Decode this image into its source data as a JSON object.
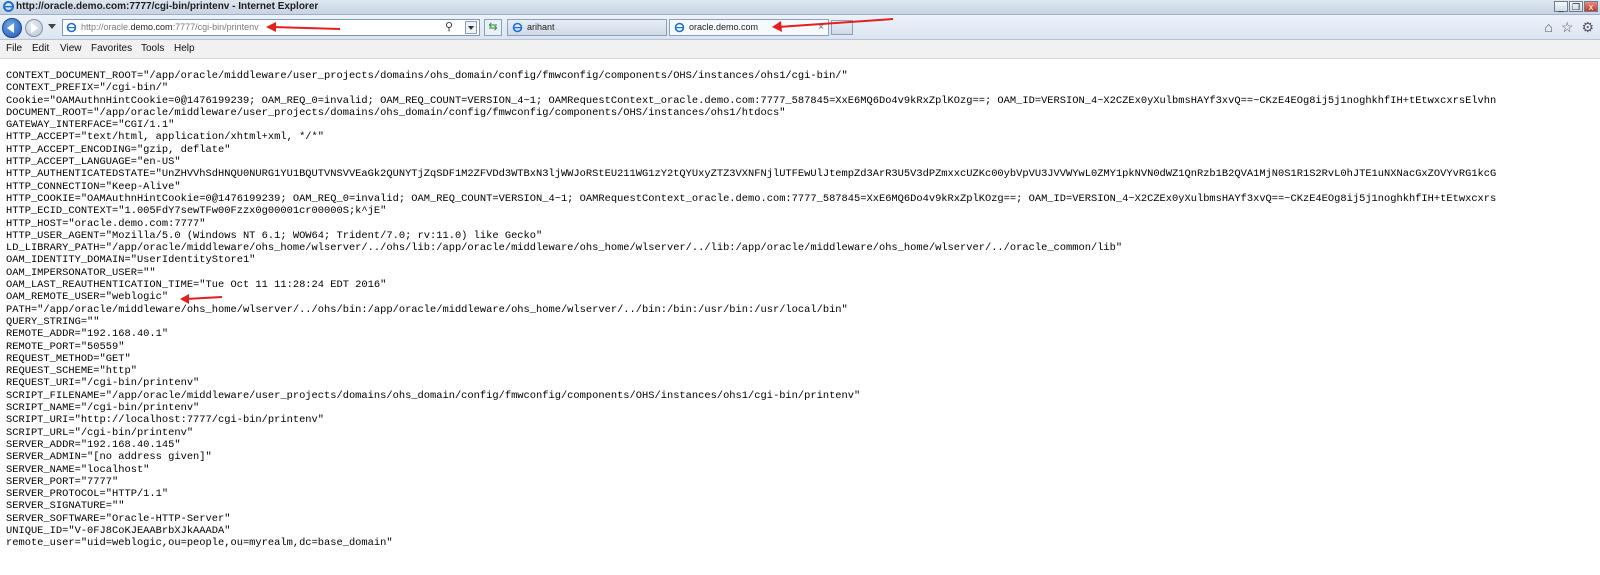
{
  "window": {
    "title": "http://oracle.demo.com:7777/cgi-bin/printenv - Internet Explorer",
    "icon": "ie-icon",
    "buttons": [
      "minimize",
      "restore",
      "close"
    ]
  },
  "navigation": {
    "back_icon": "back-arrow-icon",
    "forward_icon": "forward-arrow-icon",
    "address": {
      "prefix": "http://oracle.",
      "host": "demo.com",
      "suffix": ":7777/cgi-bin/printenv"
    },
    "tabs": [
      {
        "label": "arihant",
        "active": false
      },
      {
        "label": "oracle.demo.com",
        "active": true,
        "close": "×"
      }
    ],
    "right_icons": [
      "home-icon",
      "star-icon",
      "gear-icon"
    ]
  },
  "menu": {
    "items": [
      "File",
      "Edit",
      "View",
      "Favorites",
      "Tools",
      "Help"
    ]
  },
  "content": {
    "lines": [
      "CONTEXT_DOCUMENT_ROOT=\"/app/oracle/middleware/user_projects/domains/ohs_domain/config/fmwconfig/components/OHS/instances/ohs1/cgi-bin/\"",
      "CONTEXT_PREFIX=\"/cgi-bin/\"",
      "Cookie=\"OAMAuthnHintCookie=0@1476199239; OAM_REQ_0=invalid; OAM_REQ_COUNT=VERSION_4~1; OAMRequestContext_oracle.demo.com:7777_587845=XxE6MQ6Do4v9kRxZplKOzg==; OAM_ID=VERSION_4~X2CZEx0yXulbmsHAYf3xvQ==~CKzE4EOg8ij5j1noghkhfIH+tEtwxcxrsElvhn",
      "DOCUMENT_ROOT=\"/app/oracle/middleware/user_projects/domains/ohs_domain/config/fmwconfig/components/OHS/instances/ohs1/htdocs\"",
      "GATEWAY_INTERFACE=\"CGI/1.1\"",
      "HTTP_ACCEPT=\"text/html, application/xhtml+xml, */*\"",
      "HTTP_ACCEPT_ENCODING=\"gzip, deflate\"",
      "HTTP_ACCEPT_LANGUAGE=\"en-US\"",
      "HTTP_AUTHENTICATEDSTATE=\"UnZHVVhSdHNQU0NURG1YU1BQUTVNSVVEaGk2QUNYTjZqSDF1M2ZFVDd3WTBxN3ljWWJoRStEU211WG1zY2tQYUxyZTZ3VXNFNjlUTFEwUlJtempZd3ArR3U5V3dPZmxxcUZKc00ybVpVU3JVVWYwL0ZMY1pkNVN0dWZ1QnRzb1B2QVA1MjN0S1R1S2RvL0hJTE1uNXNacGxZOVYvRG1kcG",
      "HTTP_CONNECTION=\"Keep-Alive\"",
      "HTTP_COOKIE=\"OAMAuthnHintCookie=0@1476199239; OAM_REQ_0=invalid; OAM_REQ_COUNT=VERSION_4~1; OAMRequestContext_oracle.demo.com:7777_587845=XxE6MQ6Do4v9kRxZplKOzg==; OAM_ID=VERSION_4~X2CZEx0yXulbmsHAYf3xvQ==~CKzE4EOg8ij5j1noghkhfIH+tEtwxcxrs",
      "HTTP_ECID_CONTEXT=\"1.005FdY7sewTFw00Fzzx0g00001cr00000S;k^jE\"",
      "HTTP_HOST=\"oracle.demo.com:7777\"",
      "HTTP_USER_AGENT=\"Mozilla/5.0 (Windows NT 6.1; WOW64; Trident/7.0; rv:11.0) like Gecko\"",
      "LD_LIBRARY_PATH=\"/app/oracle/middleware/ohs_home/wlserver/../ohs/lib:/app/oracle/middleware/ohs_home/wlserver/../lib:/app/oracle/middleware/ohs_home/wlserver/../oracle_common/lib\"",
      "OAM_IDENTITY_DOMAIN=\"UserIdentityStore1\"",
      "OAM_IMPERSONATOR_USER=\"\"",
      "OAM_LAST_REAUTHENTICATION_TIME=\"Tue Oct 11 11:28:24 EDT 2016\"",
      "OAM_REMOTE_USER=\"weblogic\"",
      "PATH=\"/app/oracle/middleware/ohs_home/wlserver/../ohs/bin:/app/oracle/middleware/ohs_home/wlserver/../bin:/bin:/usr/bin:/usr/local/bin\"",
      "QUERY_STRING=\"\"",
      "REMOTE_ADDR=\"192.168.40.1\"",
      "REMOTE_PORT=\"50559\"",
      "REQUEST_METHOD=\"GET\"",
      "REQUEST_SCHEME=\"http\"",
      "REQUEST_URI=\"/cgi-bin/printenv\"",
      "SCRIPT_FILENAME=\"/app/oracle/middleware/user_projects/domains/ohs_domain/config/fmwconfig/components/OHS/instances/ohs1/cgi-bin/printenv\"",
      "SCRIPT_NAME=\"/cgi-bin/printenv\"",
      "SCRIPT_URI=\"http://localhost:7777/cgi-bin/printenv\"",
      "SCRIPT_URL=\"/cgi-bin/printenv\"",
      "SERVER_ADDR=\"192.168.40.145\"",
      "SERVER_ADMIN=\"[no address given]\"",
      "SERVER_NAME=\"localhost\"",
      "SERVER_PORT=\"7777\"",
      "SERVER_PROTOCOL=\"HTTP/1.1\"",
      "SERVER_SIGNATURE=\"\"",
      "SERVER_SOFTWARE=\"Oracle-HTTP-Server\"",
      "UNIQUE_ID=\"V-0FJ8CoKJEAABrbXJkAAADA\"",
      "remote_user=\"uid=weblogic,ou=people,ou=myrealm,dc=base_domain\""
    ]
  },
  "colors": {
    "annotation_arrow": "#e41f1f",
    "titlebar": "#c6d3e3",
    "menubar": "#f1f1f1"
  }
}
